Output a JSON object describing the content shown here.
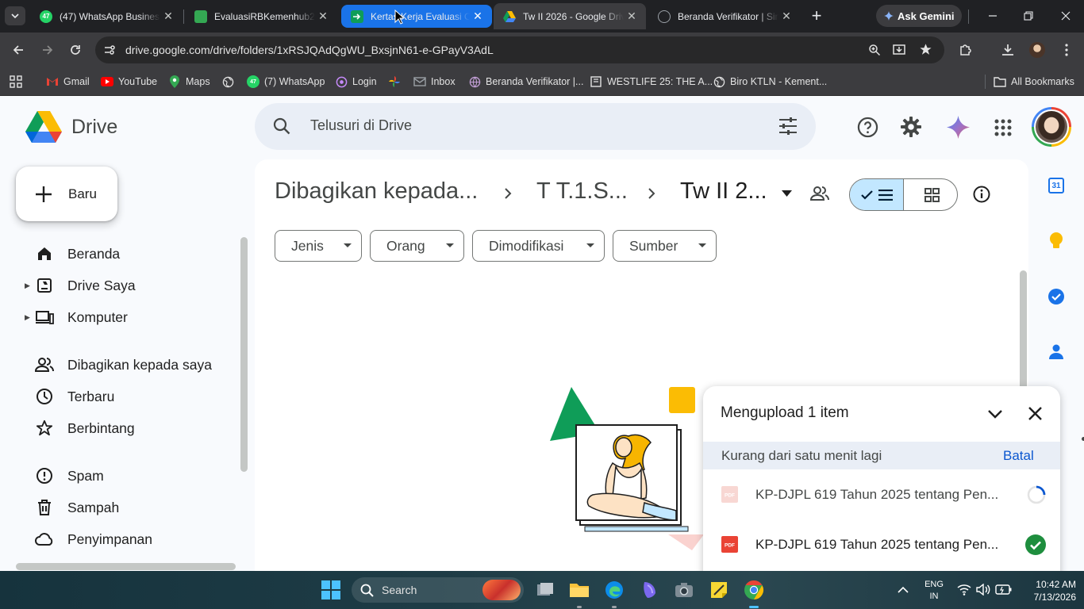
{
  "browser": {
    "tabs": [
      {
        "title": "(47) WhatsApp Business",
        "favicon": "whatsapp-icon",
        "close": "✕"
      },
      {
        "title": "EvaluasiRBKemenhub2026",
        "favicon": "app-icon",
        "close": "✕"
      },
      {
        "title": "Kertas Kerja Evaluasi Ormas",
        "favicon": "sheets-icon",
        "close": "✕"
      },
      {
        "title": "Tw II 2026 - Google Drive",
        "favicon": "drive-icon",
        "close": "✕"
      },
      {
        "title": "Beranda Verifikator | Sinar",
        "favicon": "globe-icon",
        "close": "✕"
      }
    ],
    "new_tab": "+",
    "ask_gemini": "Ask Gemini",
    "url": "drive.google.com/drive/folders/1xRSJQAdQgWU_BxsjnN61-e-GPayV3AdL",
    "bookmarks": [
      {
        "label": "Gmail",
        "icon": "gmail-icon"
      },
      {
        "label": "YouTube",
        "icon": "youtube-icon"
      },
      {
        "label": "Maps",
        "icon": "maps-icon"
      },
      {
        "label": "",
        "icon": "globe-icon"
      },
      {
        "label": "(7) WhatsApp",
        "icon": "whatsapp-icon"
      },
      {
        "label": "Login",
        "icon": "login-icon"
      },
      {
        "label": "",
        "icon": "photos-icon"
      },
      {
        "label": "Inbox",
        "icon": "inbox-icon"
      },
      {
        "label": "Beranda Verifikator |...",
        "icon": "globe-icon"
      },
      {
        "label": "WESTLIFE 25: THE A...",
        "icon": "bookmark-icon"
      },
      {
        "label": "Biro KTLN - Kement...",
        "icon": "globe-icon"
      }
    ],
    "all_bookmarks": "All Bookmarks"
  },
  "drive": {
    "logo_text": "Drive",
    "search_placeholder": "Telusuri di Drive",
    "new_button": "Baru",
    "nav": [
      {
        "label": "Beranda",
        "icon": "home-icon"
      },
      {
        "label": "Drive Saya",
        "icon": "my-drive-icon"
      },
      {
        "label": "Komputer",
        "icon": "computer-icon"
      },
      {
        "label": "Dibagikan kepada saya",
        "icon": "shared-icon"
      },
      {
        "label": "Terbaru",
        "icon": "clock-icon"
      },
      {
        "label": "Berbintang",
        "icon": "star-icon"
      },
      {
        "label": "Spam",
        "icon": "spam-icon"
      },
      {
        "label": "Sampah",
        "icon": "trash-icon"
      },
      {
        "label": "Penyimpanan",
        "icon": "cloud-icon"
      }
    ],
    "breadcrumb": [
      "Dibagikan kepada...",
      "T T.1.S...",
      "Tw II 2..."
    ],
    "filters": [
      "Jenis",
      "Orang",
      "Dimodifikasi",
      "Sumber"
    ],
    "right_panel": {
      "calendar_day": "31"
    },
    "upload_panel": {
      "title": "Mengupload 1 item",
      "status": "Kurang dari satu menit lagi",
      "cancel": "Batal",
      "items": [
        {
          "name": "KP-DJPL 619 Tahun 2025 tentang Pen...",
          "state": "uploading"
        },
        {
          "name": "KP-DJPL 619 Tahun 2025 tentang Pen...",
          "state": "done"
        }
      ]
    }
  },
  "taskbar": {
    "search": "Search",
    "lang": "ENG",
    "region": "IN",
    "time": "10:42 AM",
    "date": "7/13/2026"
  },
  "colors": {
    "accent": "#0b57d0",
    "selected_toggle": "#c2e7ff",
    "tab_group": "#1a73e8",
    "success": "#1e8e3e"
  }
}
